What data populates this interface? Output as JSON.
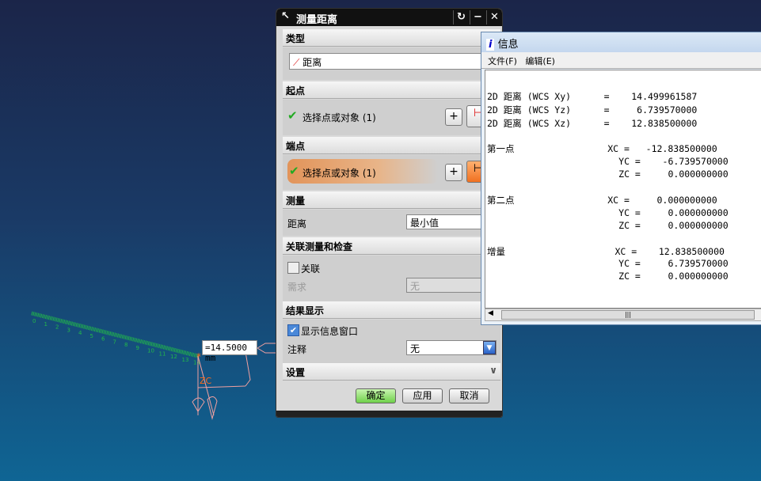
{
  "graphics": {
    "dimension_label": "=14.5000 mm",
    "ruler_ticks": [
      "0",
      "1",
      "2",
      "3",
      "4",
      "5",
      "6",
      "7",
      "8",
      "9",
      "10",
      "11",
      "12",
      "13",
      "14"
    ],
    "wcs_label": "ZC",
    "axis_labels": [
      "Z",
      "X",
      "Y"
    ],
    "ruler_color": "#22b84a",
    "wcs_color": "#f0a0a0"
  },
  "dialog": {
    "title": "测量距离",
    "reset_icon": "↻",
    "minimize_icon": "−",
    "close_icon": "✕",
    "sections": {
      "type": "类型",
      "start": "起点",
      "end": "端点",
      "measure": "测量",
      "assoc": "关联测量和检查",
      "result": "结果显示",
      "settings": "设置"
    },
    "type_value": "距离",
    "start_select": "选择点或对象 (1)",
    "end_select": "选择点或对象 (1)",
    "measure_label": "距离",
    "measure_value": "最小值",
    "assoc_checkbox": "关联",
    "assoc_checked": false,
    "requirement_label": "需求",
    "requirement_value": "无",
    "show_info_checkbox": "显示信息窗口",
    "show_info_checked": true,
    "annotation_label": "注释",
    "annotation_value": "无",
    "ok": "确定",
    "apply": "应用",
    "cancel": "取消",
    "highlight_color": "#e59a5c"
  },
  "info": {
    "title": "信息",
    "menu": [
      "文件(F)",
      "编辑(E)"
    ],
    "lines": [
      {
        "text": "2D 距离 (WCS Xy)      =    14.499961587"
      },
      {
        "text": "2D 距离 (WCS Yz)      =     6.739570000"
      },
      {
        "text": "2D 距离 (WCS Xz)      =    12.838500000"
      },
      {
        "text": "第一点                 XC =   -12.838500000"
      },
      {
        "text": "                        YC =    -6.739570000"
      },
      {
        "text": "                        ZC =     0.000000000"
      },
      {
        "text": "第二点                 XC =     0.000000000"
      },
      {
        "text": "                        YC =     0.000000000"
      },
      {
        "text": "                        ZC =     0.000000000"
      },
      {
        "text": "增量                    XC =    12.838500000"
      },
      {
        "text": "                        YC =     6.739570000"
      },
      {
        "text": "                        ZC =     0.000000000"
      }
    ]
  }
}
